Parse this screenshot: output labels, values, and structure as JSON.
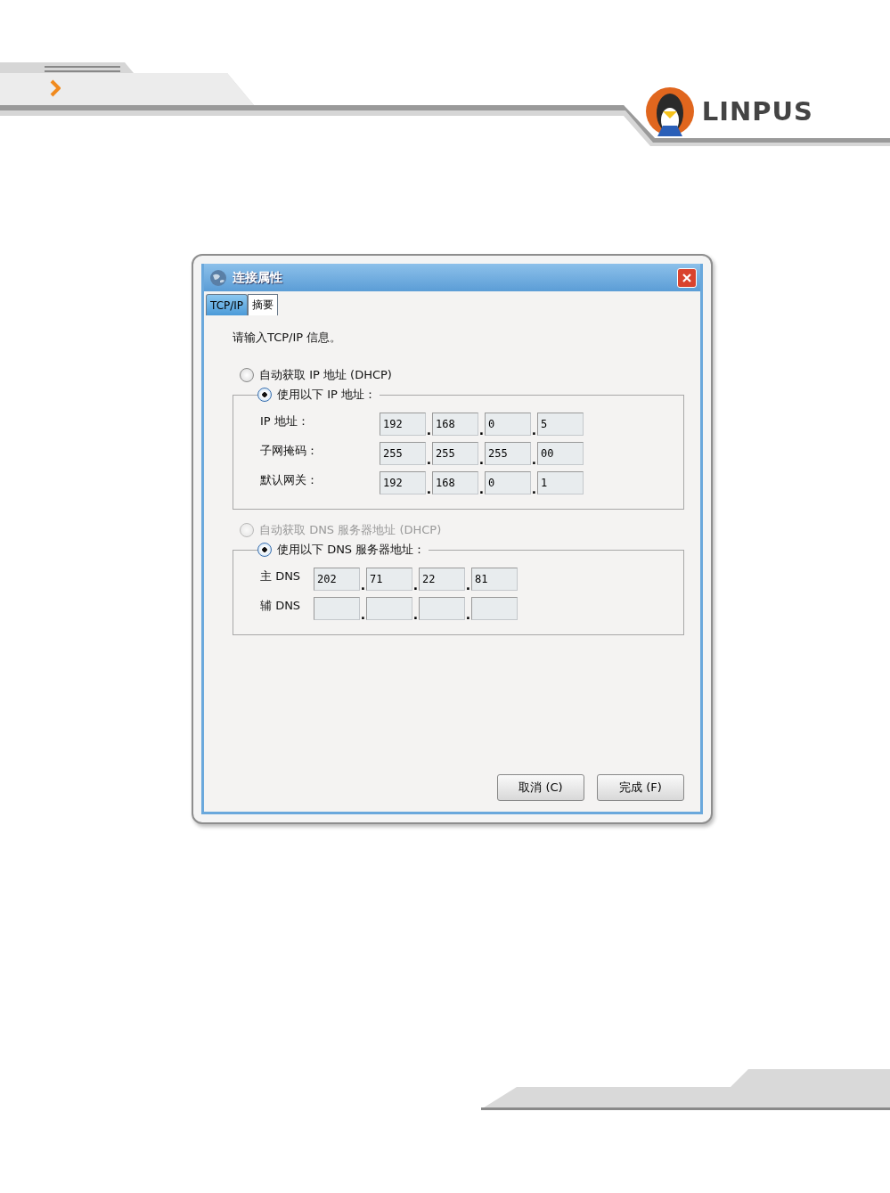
{
  "header": {
    "logo_text": "LINPUS"
  },
  "dialog": {
    "title": "连接属性"
  },
  "tabs": [
    {
      "label": "TCP/IP",
      "selected": true
    },
    {
      "label": "摘要",
      "selected": false
    }
  ],
  "prompt": "请输入TCP/IP 信息。",
  "sections": [
    {
      "auto_option": {
        "label": "自动获取 IP 地址 (DHCP)",
        "selected": false,
        "disabled": false
      },
      "manual_option": {
        "label": "使用以下 IP 地址：",
        "selected": true
      },
      "kind": "ip",
      "fields": [
        {
          "label": "IP 地址：",
          "separator": ".",
          "octets": [
            {
              "value": "192"
            },
            {
              "value": "168"
            },
            {
              "value": "0"
            },
            {
              "value": "5"
            }
          ]
        },
        {
          "label": "子网掩码：",
          "separator": ".",
          "octets": [
            {
              "value": "255"
            },
            {
              "value": "255"
            },
            {
              "value": "255"
            },
            {
              "value": "00"
            }
          ]
        },
        {
          "label": "默认网关：",
          "separator": ".",
          "octets": [
            {
              "value": "192"
            },
            {
              "value": "168"
            },
            {
              "value": "0"
            },
            {
              "value": "1"
            }
          ]
        }
      ]
    },
    {
      "auto_option": {
        "label": "自动获取 DNS 服务器地址 (DHCP)",
        "selected": false,
        "disabled": true
      },
      "manual_option": {
        "label": "使用以下 DNS 服务器地址：",
        "selected": true
      },
      "kind": "dns",
      "fields": [
        {
          "label": "主 DNS",
          "separator": ".",
          "octets": [
            {
              "value": "202"
            },
            {
              "value": "71"
            },
            {
              "value": "22"
            },
            {
              "value": "81"
            }
          ]
        },
        {
          "label": "辅 DNS",
          "separator": ".",
          "blank": true
        }
      ]
    }
  ],
  "buttons": [
    "取消 (C)",
    "完成 (F)"
  ]
}
